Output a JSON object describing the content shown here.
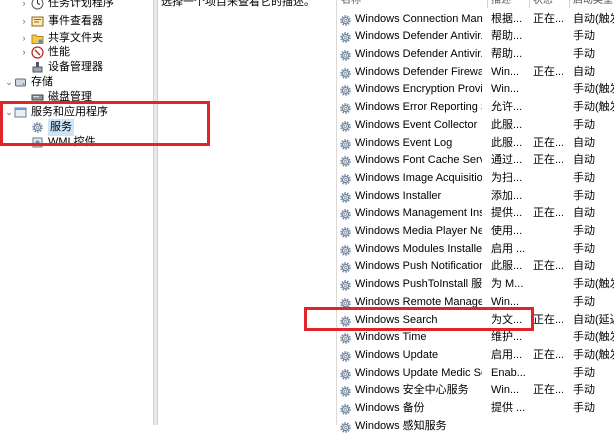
{
  "tree": {
    "items": [
      {
        "label": "任务计划程序",
        "icon": "calendar-clock-icon",
        "expander": "›"
      },
      {
        "label": "事件查看器",
        "icon": "event-viewer-icon",
        "expander": "›"
      },
      {
        "label": "共享文件夹",
        "icon": "shared-folder-icon",
        "expander": "›"
      },
      {
        "label": "性能",
        "icon": "performance-icon",
        "expander": "›"
      },
      {
        "label": "设备管理器",
        "icon": "device-manager-icon",
        "expander": ""
      },
      {
        "label": "存储",
        "icon": "storage-icon",
        "expander": "⌄"
      },
      {
        "label": "磁盘管理",
        "icon": "disk-management-icon",
        "expander": ""
      },
      {
        "label": "服务和应用程序",
        "icon": "services-apps-icon",
        "expander": "⌄"
      },
      {
        "label": "服务",
        "icon": "services-gear-icon",
        "expander": "",
        "selected": true
      },
      {
        "label": "WMI 控件",
        "icon": "wmi-control-icon",
        "expander": ""
      }
    ]
  },
  "description_pane": {
    "text": "选择一个项目来查看它的描述。"
  },
  "list": {
    "columns": [
      "名称",
      "描述",
      "状态",
      "启动类型"
    ],
    "rows": [
      {
        "name": "Windows Connection Man...",
        "desc": "根据...",
        "status": "正在...",
        "start": "自动(触发"
      },
      {
        "name": "Windows Defender Antivir...",
        "desc": "帮助...",
        "status": "",
        "start": "手动"
      },
      {
        "name": "Windows Defender Antivir...",
        "desc": "帮助...",
        "status": "",
        "start": "手动"
      },
      {
        "name": "Windows Defender Firewall",
        "desc": "Win...",
        "status": "正在...",
        "start": "自动"
      },
      {
        "name": "Windows Encryption Provid...",
        "desc": "Win...",
        "status": "",
        "start": "手动(触发"
      },
      {
        "name": "Windows Error Reporting S...",
        "desc": "允许...",
        "status": "",
        "start": "手动(触发"
      },
      {
        "name": "Windows Event Collector",
        "desc": "此服...",
        "status": "",
        "start": "手动"
      },
      {
        "name": "Windows Event Log",
        "desc": "此服...",
        "status": "正在...",
        "start": "自动"
      },
      {
        "name": "Windows Font Cache Servi...",
        "desc": "通过...",
        "status": "正在...",
        "start": "自动"
      },
      {
        "name": "Windows Image Acquisitio...",
        "desc": "为扫...",
        "status": "",
        "start": "手动"
      },
      {
        "name": "Windows Installer",
        "desc": "添加...",
        "status": "",
        "start": "手动"
      },
      {
        "name": "Windows Management Ins...",
        "desc": "提供...",
        "status": "正在...",
        "start": "自动"
      },
      {
        "name": "Windows Media Player Net...",
        "desc": "使用...",
        "status": "",
        "start": "手动"
      },
      {
        "name": "Windows Modules Installer",
        "desc": "启用 ...",
        "status": "",
        "start": "手动"
      },
      {
        "name": "Windows Push Notification...",
        "desc": "此服...",
        "status": "正在...",
        "start": "自动"
      },
      {
        "name": "Windows PushToInstall 服务",
        "desc": "为 M...",
        "status": "",
        "start": "手动(触发"
      },
      {
        "name": "Windows Remote Manage...",
        "desc": "Win...",
        "status": "",
        "start": "手动"
      },
      {
        "name": "Windows Search",
        "desc": "为文...",
        "status": "正在...",
        "start": "自动(延迟"
      },
      {
        "name": "Windows Time",
        "desc": "维护...",
        "status": "",
        "start": "手动(触发"
      },
      {
        "name": "Windows Update",
        "desc": "启用...",
        "status": "正在...",
        "start": "手动(触发"
      },
      {
        "name": "Windows Update Medic Se...",
        "desc": "Enab...",
        "status": "",
        "start": "手动"
      },
      {
        "name": "Windows 安全中心服务",
        "desc": "Win...",
        "status": "正在...",
        "start": "手动"
      },
      {
        "name": "Windows 备份",
        "desc": "提供 ...",
        "status": "",
        "start": "手动"
      },
      {
        "name": "Windows 感知服务",
        "desc": "",
        "status": "",
        "start": ""
      }
    ]
  },
  "highlight": {
    "color": "#e0242b"
  }
}
